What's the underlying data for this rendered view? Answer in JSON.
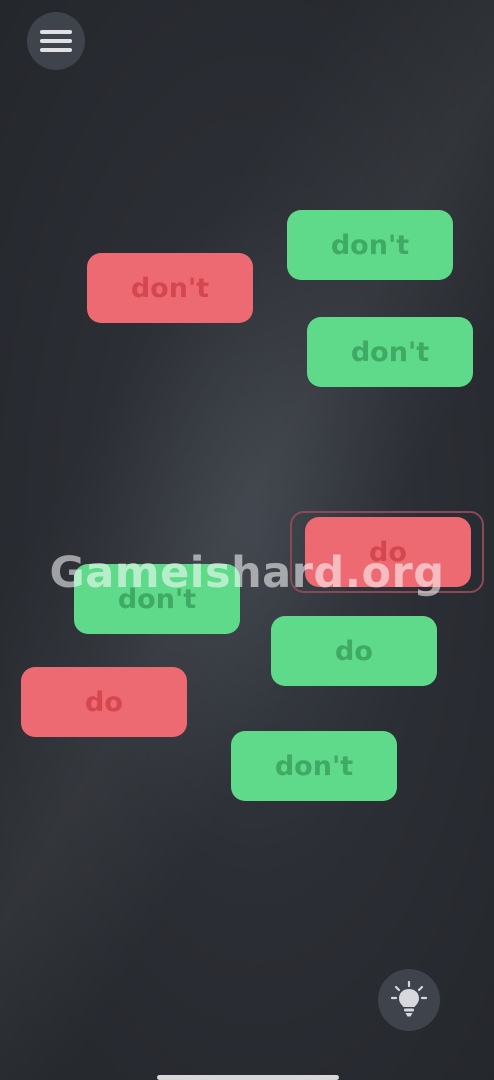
{
  "menu_button": {
    "icon": "hamburger-menu-icon"
  },
  "hint_button": {
    "icon": "lightbulb-icon"
  },
  "tiles": [
    {
      "label": "don't",
      "color": "green",
      "fill": "#5fd98a",
      "text_color": "#3eaa63"
    },
    {
      "label": "don't",
      "color": "red",
      "fill": "#ee6a72",
      "text_color": "#d4474f"
    },
    {
      "label": "don't",
      "color": "green",
      "fill": "#5fd98a",
      "text_color": "#3eaa63"
    },
    {
      "label": "do",
      "color": "red",
      "fill": "#ee6a72",
      "text_color": "#d4474f",
      "selected": true
    },
    {
      "label": "don't",
      "color": "green",
      "fill": "#5fd98a",
      "text_color": "#3eaa63"
    },
    {
      "label": "do",
      "color": "green",
      "fill": "#5fd98a",
      "text_color": "#3eaa63"
    },
    {
      "label": "do",
      "color": "red",
      "fill": "#ee6a72",
      "text_color": "#d4474f"
    },
    {
      "label": "don't",
      "color": "green",
      "fill": "#5fd98a",
      "text_color": "#3eaa63"
    }
  ],
  "watermark": "Gameishard.org"
}
